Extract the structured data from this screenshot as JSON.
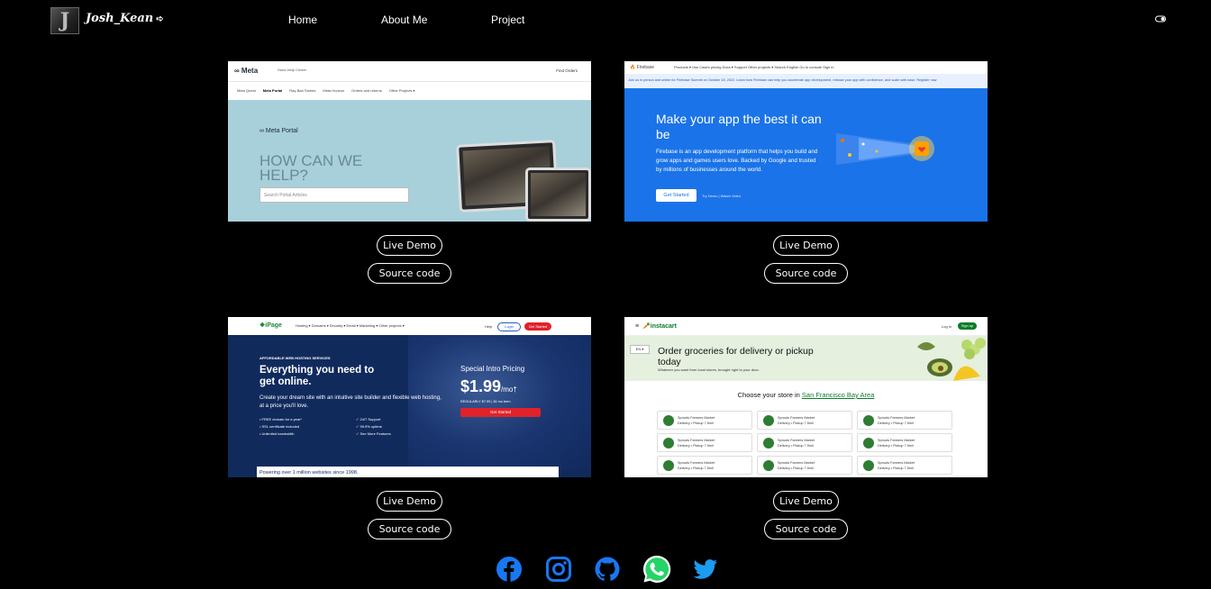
{
  "nav": {
    "brand": "Josh_Kean",
    "logo_letter": "J",
    "brand_arrow": "➪",
    "links": [
      "Home",
      "About Me",
      "Project"
    ]
  },
  "projects": [
    {
      "thumb": {
        "logo": "∞ Meta",
        "subtitle": "Store Help Center",
        "find": "Find Orders",
        "tabs": [
          "Meta Quest",
          "Meta Portal",
          "Ray-Ban Stories",
          "Meta Horizon",
          "Orders and returns",
          "Other Projects ▾"
        ],
        "product": "∞ Meta Portal",
        "headline": "HOW CAN WE HELP?",
        "search_placeholder": "Search Portal Articles"
      },
      "live_label": "Live Demo",
      "source_label": "Source code"
    },
    {
      "thumb": {
        "logo": "🔥 Firebase",
        "menu": "Products ▾  Use Cases  pricing  Docs ▾  Support  Other projects ▾      Search              English          Go to console  Sign in",
        "banner": "Join us in person and online for Firebase Summit on October 18, 2022. Learn how Firebase can help you accelerate app development, release your app with confidence, and scale with ease. Register now",
        "headline": "Make your app the best it can be",
        "body": "Firebase is an app development platform that helps you build and grow apps and games users love. Backed by Google and trusted by millions of businesses around the world.",
        "cta": "Get Started",
        "links": "Try Demo  |  Watch Video"
      },
      "live_label": "Live Demo",
      "source_label": "Source code"
    },
    {
      "thumb": {
        "logo": "❖iPage",
        "menu": "Hosting ▾   Domains ▾   Security ▾   Email ▾   Marketing ▾   Other projects ▾",
        "help": "Help",
        "login": "Login",
        "getstarted": "Get Started",
        "kicker": "AFFORDABLE WEB HOSTING SERVICES",
        "headline": "Everything you need to get online.",
        "body": "Create your dream site with an intuitive site builder and flexible web hosting, at a price you'll love.",
        "features_left": [
          "• FREE domain for a year*",
          "• SSL certificate included",
          "• Unlimited bandwidth"
        ],
        "features_right": [
          "✓ 24/7 Support",
          "✓ 99.9% uptime",
          "✓ See More Features"
        ],
        "price_label": "Special Intro Pricing",
        "price": "$1.99",
        "price_unit": "/mo†",
        "regular": "REGULARLY $7.99 | 36 mo term",
        "cta": "Get Started",
        "footer": "Powering over 1 million websites since 1998."
      },
      "live_label": "Live Demo",
      "source_label": "Source code"
    },
    {
      "thumb": {
        "logo": "🥕instacart",
        "login": "Log in",
        "signup": "Sign up",
        "lang": "EN ▾",
        "headline": "Order groceries for delivery or pickup today",
        "sub": "Whatever you want from local stores, brought right to your door.",
        "choose": "Choose your store in",
        "city": "San Francisco Bay Area",
        "store_name": "Sprouts Farmers Market",
        "store_meta": "Delivery • Pickup 7.5mil"
      },
      "live_label": "Live Demo",
      "source_label": "Source code"
    }
  ],
  "social": [
    {
      "name": "facebook-icon",
      "color": "#1877f2"
    },
    {
      "name": "instagram-icon",
      "color": "#1877f2"
    },
    {
      "name": "github-icon",
      "color": "#1877f2"
    },
    {
      "name": "whatsapp-icon",
      "color": "#25d366"
    },
    {
      "name": "twitter-icon",
      "color": "#1d9bf0"
    }
  ]
}
